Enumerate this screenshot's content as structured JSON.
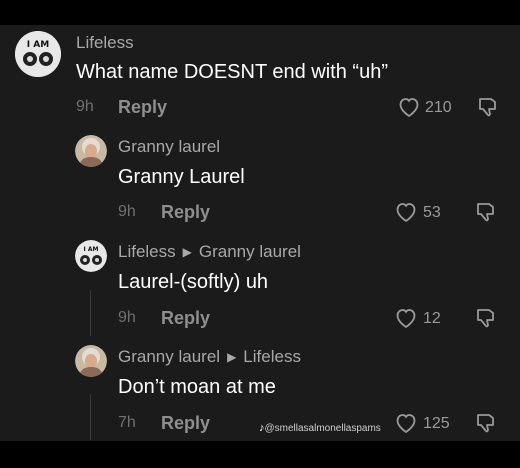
{
  "comments": [
    {
      "author": "Lifeless",
      "text": "What name DOESNT end with “uh”",
      "time": "9h",
      "reply": "Reply",
      "likes": "210"
    },
    {
      "author": "Granny laurel",
      "text": "Granny Laurel",
      "time": "9h",
      "reply": "Reply",
      "likes": "53"
    },
    {
      "author": "Lifeless",
      "reply_to": "Granny laurel",
      "text": "Laurel-(softly) uh",
      "time": "9h",
      "reply": "Reply",
      "likes": "12"
    },
    {
      "author": "Granny laurel",
      "reply_to": "Lifeless",
      "text": "Don’t moan at me",
      "time": "7h",
      "reply": "Reply",
      "likes": "125"
    }
  ],
  "avatar_text": "I AM",
  "watermark": "@smellasalmonellaspams",
  "icons": {
    "like": "heart-outline-icon",
    "dislike": "thumbs-down-icon",
    "reply_arrow": "triangle-right-icon",
    "tiktok": "tiktok-logo-icon"
  },
  "colors": {
    "background": "#1b1b1b",
    "frame": "#000000",
    "text": "#ffffff",
    "secondary": "#a8a8a8"
  }
}
